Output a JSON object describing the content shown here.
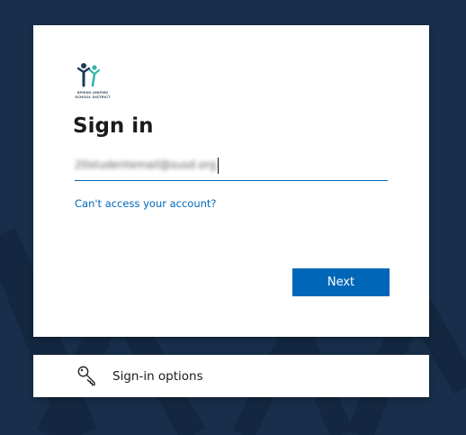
{
  "theme": {
    "background": "#172f4b",
    "accent": "#0067b8",
    "card": "#ffffff",
    "text": "#1b1b1b"
  },
  "org": {
    "logo_text": "SPHINX UNIFIED SCHOOL DISTRICT",
    "logo_icon": "stick-figures-logo"
  },
  "signin": {
    "title": "Sign in",
    "email_value": "20studentemail@susd.org",
    "cant_access_link": "Can't access your account?",
    "next_button": "Next"
  },
  "options": {
    "label": "Sign-in options",
    "icon": "key-icon"
  }
}
